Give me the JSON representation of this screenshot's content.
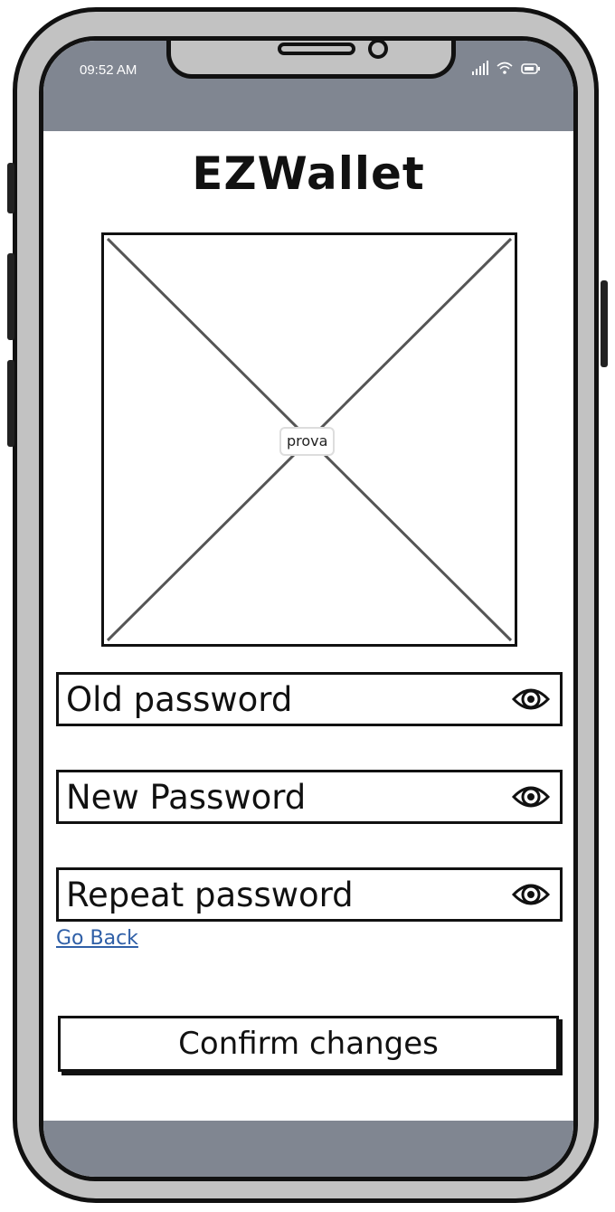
{
  "status_bar": {
    "time": "09:52 AM",
    "icons": [
      "signal-icon",
      "wifi-icon",
      "battery-icon"
    ]
  },
  "app": {
    "title": "EZWallet"
  },
  "image_placeholder": {
    "label": "prova"
  },
  "form": {
    "old_password_placeholder": "Old password",
    "new_password_placeholder": "New Password",
    "repeat_password_placeholder": "Repeat password",
    "field_icon": "eye-icon"
  },
  "links": {
    "go_back": "Go Back"
  },
  "buttons": {
    "confirm": "Confirm changes"
  },
  "colors": {
    "bar_gray": "#808691",
    "frame_gray": "#c2c2c2",
    "link_blue": "#2f5fa7"
  }
}
